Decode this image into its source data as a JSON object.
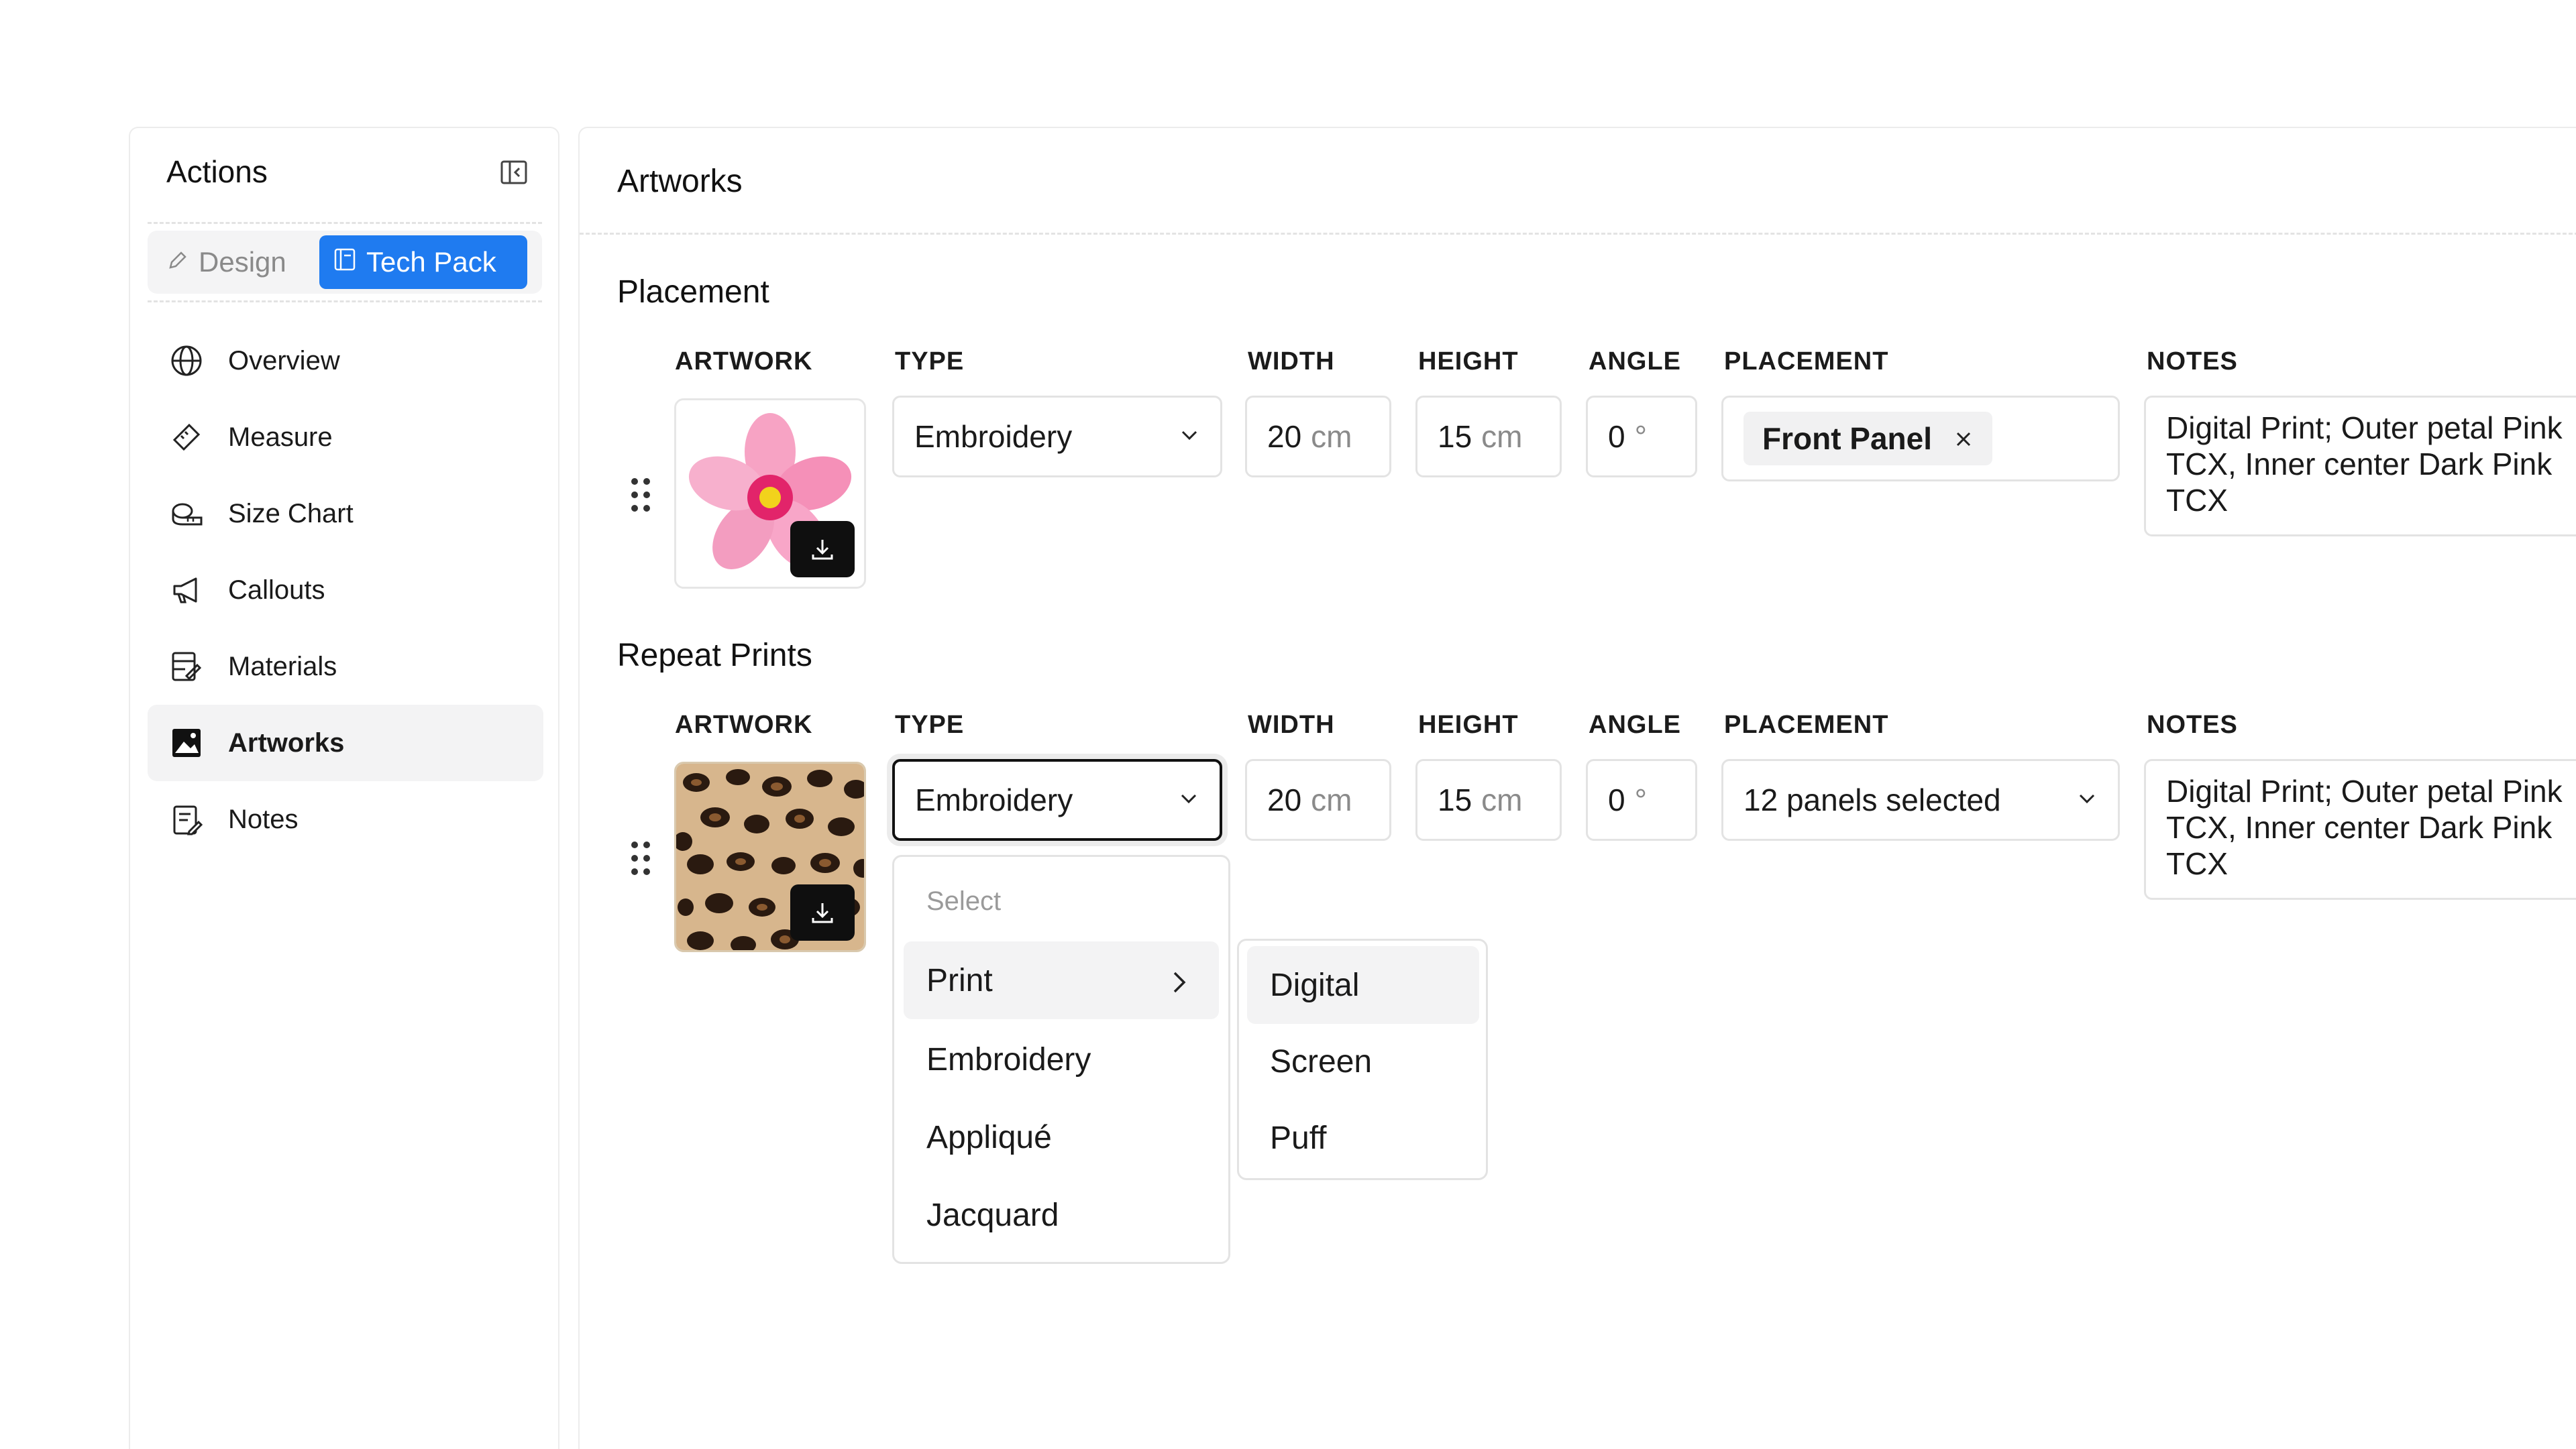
{
  "sidebar": {
    "title": "Actions",
    "tabs": {
      "design": "Design",
      "tech_pack": "Tech Pack"
    },
    "items": [
      {
        "label": "Overview",
        "icon": "globe-icon"
      },
      {
        "label": "Measure",
        "icon": "ruler-icon"
      },
      {
        "label": "Size Chart",
        "icon": "tape-measure-icon"
      },
      {
        "label": "Callouts",
        "icon": "megaphone-icon"
      },
      {
        "label": "Materials",
        "icon": "materials-icon"
      },
      {
        "label": "Artworks",
        "icon": "image-icon",
        "active": true
      },
      {
        "label": "Notes",
        "icon": "notes-icon"
      }
    ]
  },
  "main": {
    "title": "Artworks",
    "headers": {
      "artwork": "ARTWORK",
      "type": "TYPE",
      "width": "WIDTH",
      "height": "HEIGHT",
      "angle": "ANGLE",
      "placement": "PLACEMENT",
      "notes": "NOTES"
    },
    "placement_section": {
      "title": "Placement",
      "row": {
        "artwork": "pink-flower-image",
        "type": "Embroidery",
        "width": "20",
        "width_unit": "cm",
        "height": "15",
        "height_unit": "cm",
        "angle": "0",
        "angle_unit": "°",
        "placement_chip": "Front Panel",
        "notes": "Digital Print; Outer petal Pink\nTCX,  Inner center Dark Pink\nTCX"
      }
    },
    "repeat_section": {
      "title": "Repeat Prints",
      "row": {
        "artwork": "leopard-print-image",
        "type": "Embroidery",
        "width": "20",
        "width_unit": "cm",
        "height": "15",
        "height_unit": "cm",
        "angle": "0",
        "angle_unit": "°",
        "placement": "12 panels selected",
        "notes": "Digital Print; Outer petal Pink\nTCX,  Inner center Dark Pink\nTCX"
      }
    }
  },
  "dropdown": {
    "header": "Select",
    "items": [
      "Print",
      "Embroidery",
      "Appliqué",
      "Jacquard"
    ],
    "submenu": [
      "Digital",
      "Screen",
      "Puff"
    ]
  },
  "colors": {
    "accent": "#1f7bf0",
    "border": "#e3e3e3",
    "hover": "#f3f3f4"
  }
}
